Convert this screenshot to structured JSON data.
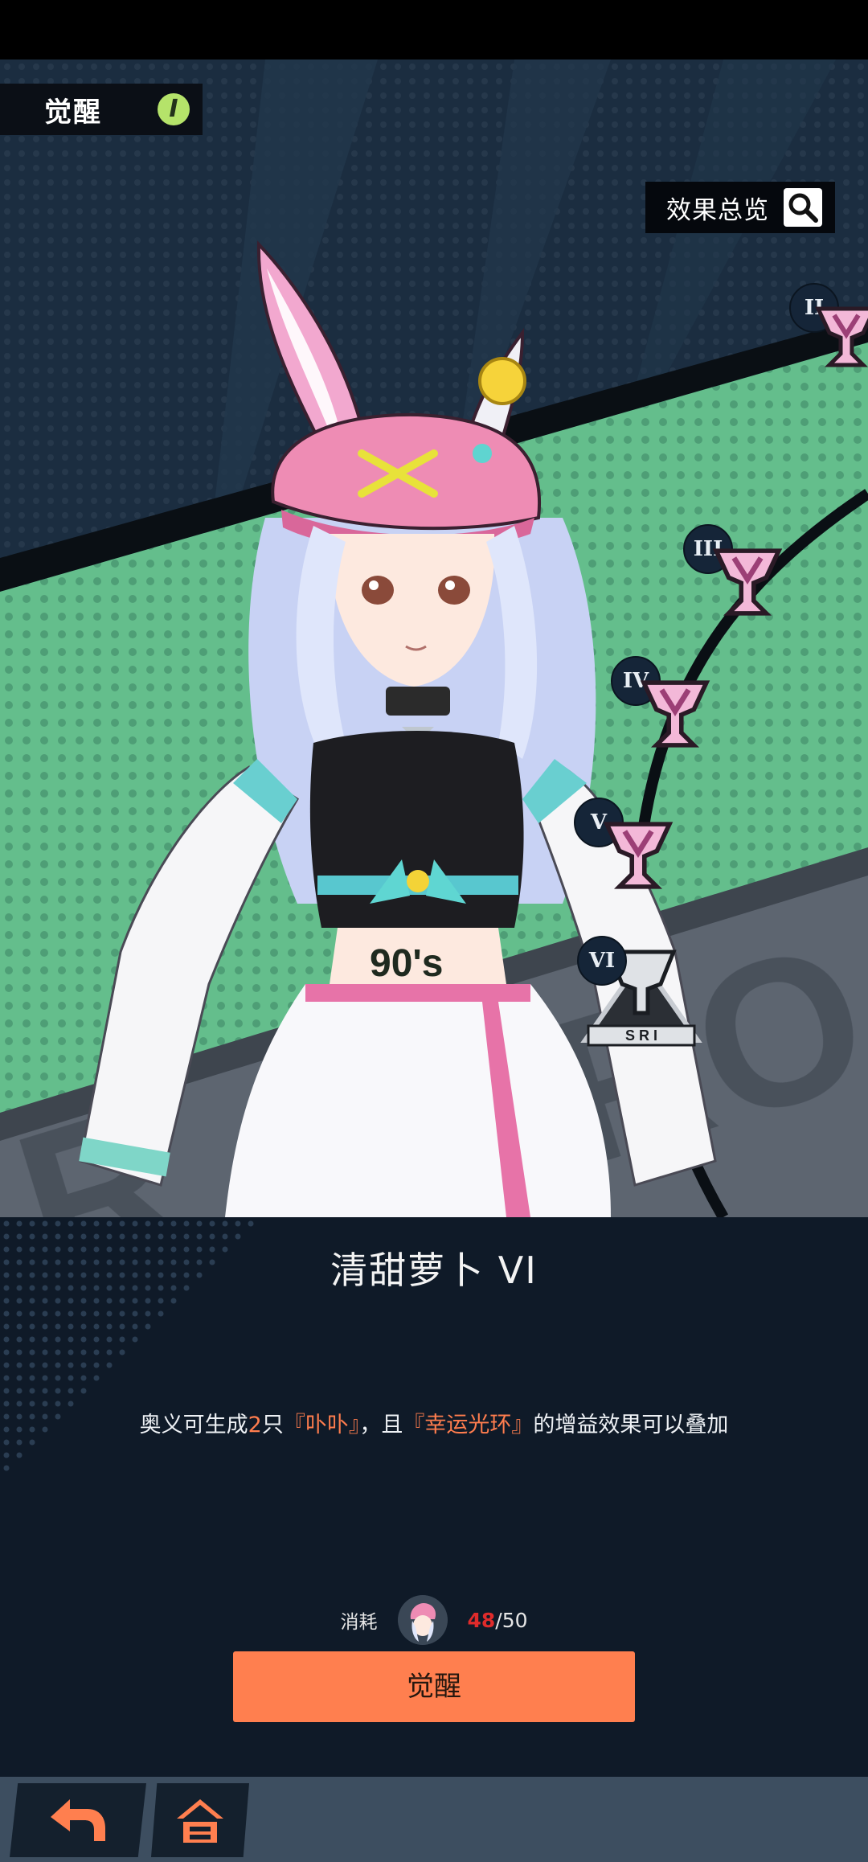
{
  "header": {
    "title": "觉醒",
    "badge": "I"
  },
  "overview": {
    "label": "效果总览",
    "icon": "search-icon"
  },
  "nodes": [
    {
      "label": "II"
    },
    {
      "label": "III"
    },
    {
      "label": "IV"
    },
    {
      "label": "V"
    },
    {
      "label": "VI",
      "emblem_text": "S R I"
    }
  ],
  "skill": {
    "name": "清甜萝卜 VI",
    "desc": {
      "p1": "奥义可生成",
      "n": "2",
      "p2": "只",
      "h1": "『卟卟』",
      "p3": "，且",
      "h2": "『幸运光环』",
      "p4": "的增益效果可以叠加"
    }
  },
  "cost": {
    "label": "消耗",
    "have": "48",
    "total": "/50"
  },
  "awaken_button": {
    "label": "觉醒"
  },
  "nav": {
    "back_icon": "back-arrow-icon",
    "home_icon": "home-icon"
  },
  "colors": {
    "accent": "#ff7f4f",
    "highlight": "#ff7d4e",
    "insufficient": "#e02b2b",
    "bg": "#0f1a28"
  }
}
